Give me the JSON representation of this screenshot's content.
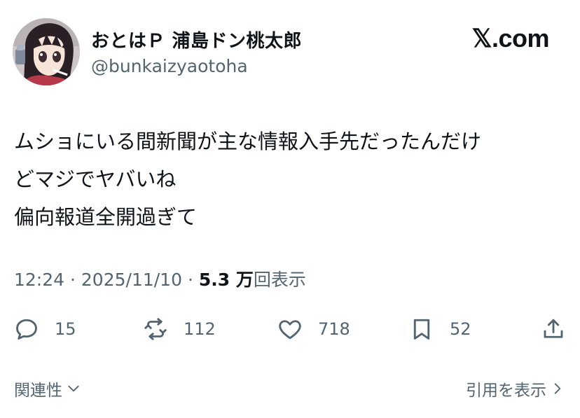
{
  "header": {
    "display_name": "おとはＰ 浦島ドン桃太郎",
    "handle": "@bunkaizyaotoha",
    "brand": "𝕏.com",
    "avatar_icon": "anime-character-avatar"
  },
  "tweet": {
    "lines": [
      "ムショにいる間新聞が主な情報入手先だったんだけ",
      "どマジでヤバいね",
      "偏向報道全開過ぎて"
    ]
  },
  "meta": {
    "time": "12:24",
    "separator": "·",
    "date": "2025/11/10",
    "views_count": "5.3 万",
    "views_label": "回表示"
  },
  "actions": {
    "replies": {
      "icon": "reply-icon",
      "count": "15"
    },
    "retweets": {
      "icon": "retweet-icon",
      "count": "112"
    },
    "likes": {
      "icon": "heart-icon",
      "count": "718"
    },
    "bookmarks": {
      "icon": "bookmark-icon",
      "count": "52"
    },
    "share": {
      "icon": "share-icon"
    }
  },
  "footer": {
    "related_label": "関連性",
    "quote_label": "引用を表示"
  },
  "colors": {
    "text": "#0f1419",
    "secondary": "#536471",
    "background": "#ffffff"
  }
}
